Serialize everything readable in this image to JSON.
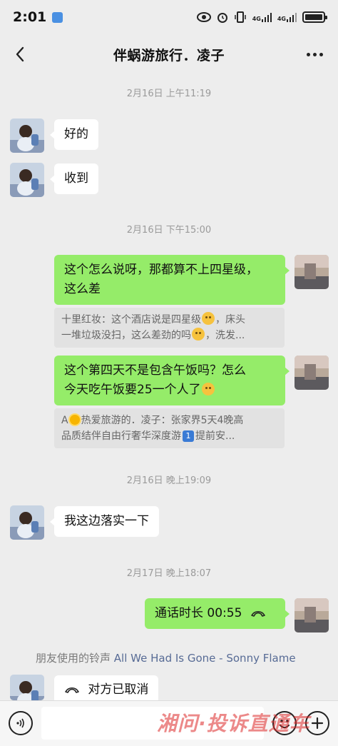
{
  "status_bar": {
    "time": "2:01",
    "net1": "4G",
    "net2": "4G",
    "icons": [
      "eye-icon",
      "alarm-icon",
      "vibrate-icon",
      "signal-icon",
      "battery-icon"
    ]
  },
  "header": {
    "title": "伴蜗游旅行．凌子",
    "back_icon": "chevron-left-icon",
    "more_icon": "more-dots-icon"
  },
  "messages": {
    "ts1": "2月16日 上午11:19",
    "m1": "好的",
    "m2": "收到",
    "ts2": "2月16日 下午15:00",
    "m3_line1": "这个怎么说呀，那都算不上四星级，",
    "m3_line2": "这么差",
    "q1_line1a": "十里红妆：这个酒店说是四星级",
    "q1_line1b": "，床头",
    "q1_line2a": "一堆垃圾没扫，这么差劲的吗",
    "q1_line2b": "，洗发...",
    "m4_line1": "这个第四天不是包含午饭吗？怎么",
    "m4_line2": "今天吃午饭要25一个人了",
    "q2_line1a": "A",
    "q2_line1b": "热爱旅游的．凌子：张家界5天4晚高",
    "q2_line2a": "品质结伴自由行奢华深度游",
    "q2_badge": "1",
    "q2_line2b": "提前安...",
    "ts3": "2月16日 晚上19:09",
    "m5": "我这边落实一下",
    "ts4": "2月17日 晚上18:07",
    "m6": "通话时长 00:55",
    "ringtone_prefix": "朋友使用的铃声",
    "ringtone_song": "All We Had Is Gone - Sonny Flame",
    "m7": "对方已取消"
  },
  "input_bar": {
    "voice_icon": "voice-icon",
    "emoji_icon": "emoji-icon",
    "plus_icon": "plus-icon"
  },
  "watermark": "湘问·投诉直通车",
  "colors": {
    "background": "#ededed",
    "bubble_mine": "#95ec69",
    "bubble_theirs": "#ffffff",
    "link": "#576b95"
  }
}
